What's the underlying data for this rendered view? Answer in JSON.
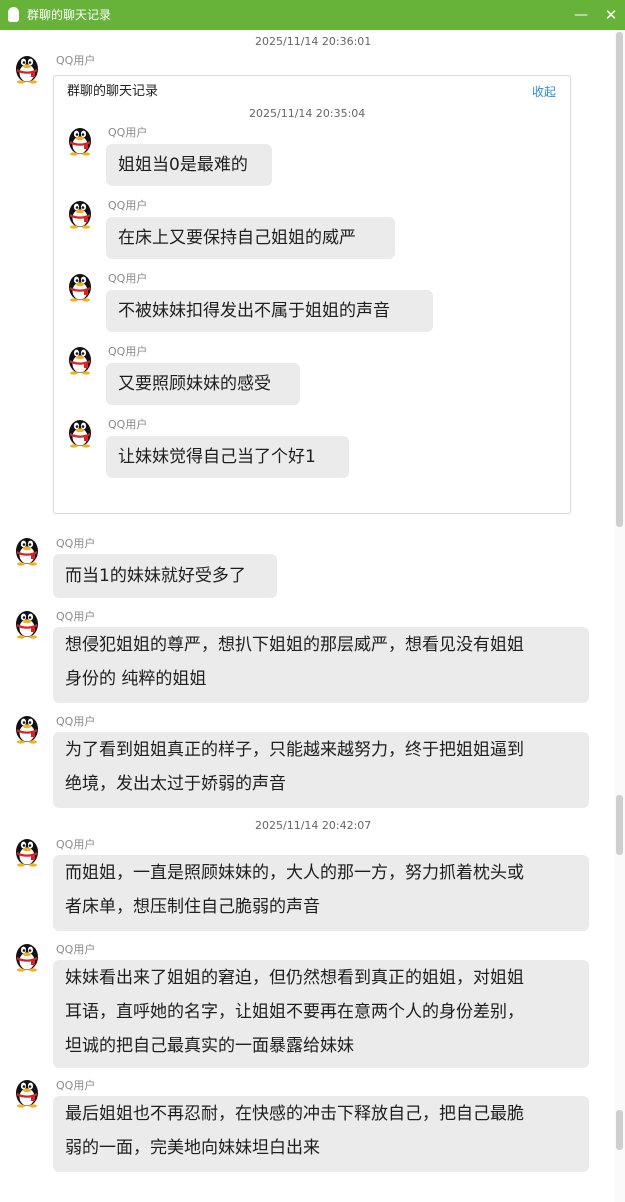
{
  "window": {
    "title": "群聊的聊天记录",
    "min_icon": "minimize-icon",
    "close_icon": "close-icon"
  },
  "colors": {
    "titlebar": "#67b33a",
    "bubble": "#ebebeb",
    "link": "#2b8bd6"
  },
  "timestamps": {
    "t1": "2025/11/14 20:36:01",
    "t_inner": "2025/11/14 20:35:04",
    "t2": "2025/11/14 20:42:07"
  },
  "forward": {
    "sender": "QQ用户",
    "title": "群聊的聊天记录",
    "collapse": "收起",
    "messages": [
      {
        "sender": "QQ用户",
        "text": "姐姐当0是最难的"
      },
      {
        "sender": "QQ用户",
        "text": "在床上又要保持自己姐姐的威严"
      },
      {
        "sender": "QQ用户",
        "text": "不被妹妹扣得发出不属于姐姐的声音"
      },
      {
        "sender": "QQ用户",
        "text": "又要照顾妹妹的感受"
      },
      {
        "sender": "QQ用户",
        "text": "让妹妹觉得自己当了个好1"
      }
    ]
  },
  "messages": [
    {
      "sender": "QQ用户",
      "lines": [
        "而当1的妹妹就好受多了"
      ]
    },
    {
      "sender": "QQ用户",
      "lines": [
        "想侵犯姐姐的尊严，想扒下姐姐的那层威严，想看见没有姐姐",
        "身份的 纯粹的姐姐"
      ]
    },
    {
      "sender": "QQ用户",
      "lines": [
        "为了看到姐姐真正的样子，只能越来越努力，终于把姐姐逼到",
        "绝境，发出太过于娇弱的声音"
      ]
    },
    {
      "sender": "QQ用户",
      "lines": [
        "而姐姐，一直是照顾妹妹的，大人的那一方，努力抓着枕头或",
        "者床单，想压制住自己脆弱的声音"
      ]
    },
    {
      "sender": "QQ用户",
      "lines": [
        "妹妹看出来了姐姐的窘迫，但仍然想看到真正的姐姐，对姐姐",
        "耳语，直呼她的名字，让姐姐不要再在意两个人的身份差别，",
        "坦诚的把自己最真实的一面暴露给妹妹"
      ]
    },
    {
      "sender": "QQ用户",
      "lines": [
        "最后姐姐也不再忍耐，在快感的冲击下释放自己，把自己最脆",
        "弱的一面，完美地向妹妹坦白出来"
      ]
    }
  ]
}
